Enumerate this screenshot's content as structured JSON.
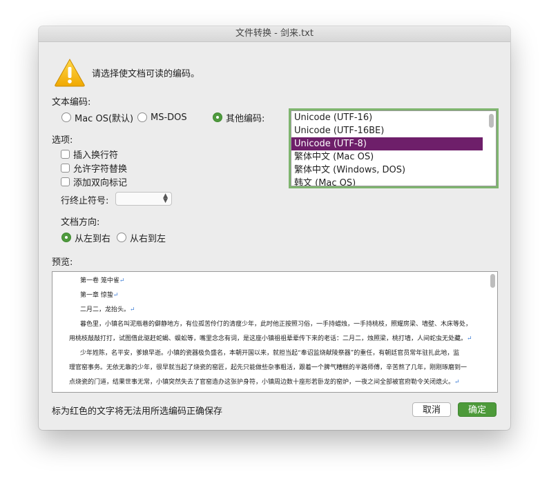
{
  "window": {
    "title": "文件转换 - 剑来.txt"
  },
  "prompt": {
    "text": "请选择使文档可读的编码。",
    "icon": "warning-icon"
  },
  "encoding": {
    "label": "文本编码:",
    "radios": [
      {
        "label": "Mac OS(默认)",
        "selected": false
      },
      {
        "label": "MS-DOS",
        "selected": false
      },
      {
        "label": "其他编码:",
        "selected": true
      }
    ],
    "list": [
      "Unicode (UTF-16)",
      "Unicode (UTF-16BE)",
      "Unicode (UTF-8)",
      "繁体中文 (Mac OS)",
      "繁体中文 (Windows, DOS)",
      "韩文 (Mac OS)"
    ],
    "selected_index": 2
  },
  "options": {
    "label": "选项:",
    "checks": [
      {
        "label": "插入换行符",
        "checked": false
      },
      {
        "label": "允许字符替换",
        "checked": false
      },
      {
        "label": "添加双向标记",
        "checked": false
      }
    ],
    "line_end_label": "行终止符号:",
    "line_end_value": ""
  },
  "direction": {
    "label": "文档方向:",
    "radios": [
      {
        "label": "从左到右",
        "selected": true
      },
      {
        "label": "从右到左",
        "selected": false
      }
    ]
  },
  "preview": {
    "label": "预览:",
    "lines": [
      "第一卷 笼中雀",
      "第一章 惊蛰",
      "二月二，龙抬头。",
      "暮色里，小镇名叫泥瓶巷的僻静地方，有位孤苦伶仃的清瘦少年，此时他正按照习俗，一手持蜡烛，一手持桃枝，照耀房梁、墙壁、木床等处，",
      "用桃枝敲敲打打，试图借此驱赶蛇蝎、蜈蚣等，嘴里念念有词，是这座小镇祖祖辈辈传下来的老话：二月二，烛照梁，桃打墙，人间蛇虫无处藏。",
      "少年姓陈，名平安，爹娘早逝。小镇的瓷器极负盛名，本朝开国以来，就担当起“奉诏监烧献陵祭器”的重任，有朝廷官员常年驻扎此地，监",
      "理官窑事务。无依无靠的少年，很早就当起了烧瓷的窑匠，起先只能做些杂事粗活，跟着一个脾气糟糕的半路师傅，辛苦熬了几年，刚刚琢磨到一",
      "点烧瓷的门道，结果世事无常，小镇突然失去了官窑造办这张护身符，小镇周边数十座形若卧龙的窑炉，一夜之间全部被官府勒令关闭熄火。"
    ],
    "para_mark": "↵"
  },
  "footer": {
    "note": "标为红色的文字将无法用所选编码正确保存",
    "cancel_label": "取消",
    "ok_label": "确定"
  },
  "colors": {
    "accent_green": "#4d9a3a",
    "selection_purple": "#6e1f6a"
  }
}
